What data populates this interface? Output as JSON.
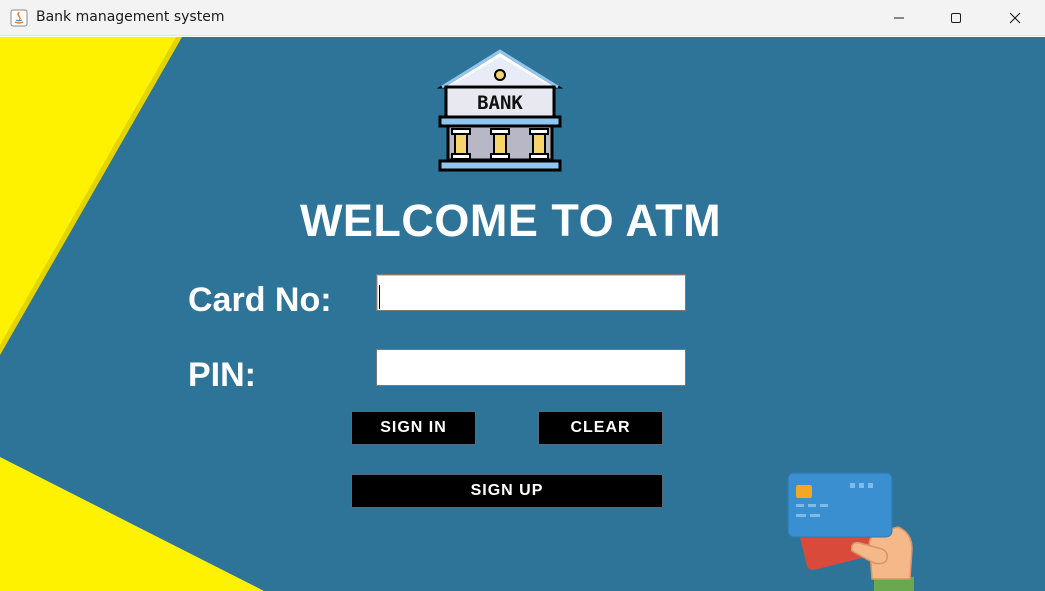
{
  "window": {
    "title": "Bank management system"
  },
  "logo": {
    "text": "BANK",
    "icon": "bank-building-icon"
  },
  "heading": "WELCOME TO ATM",
  "form": {
    "card_label": "Card No:",
    "card_value": "",
    "pin_label": "PIN:",
    "pin_value": ""
  },
  "buttons": {
    "sign_in": "SIGN IN",
    "clear": "CLEAR",
    "sign_up": "SIGN UP"
  },
  "illustration": {
    "icon": "hand-holding-credit-card-icon"
  },
  "colors": {
    "background": "#2e7498",
    "accent_yellow": "#ffee00",
    "button": "#000000",
    "text": "#ffffff"
  }
}
